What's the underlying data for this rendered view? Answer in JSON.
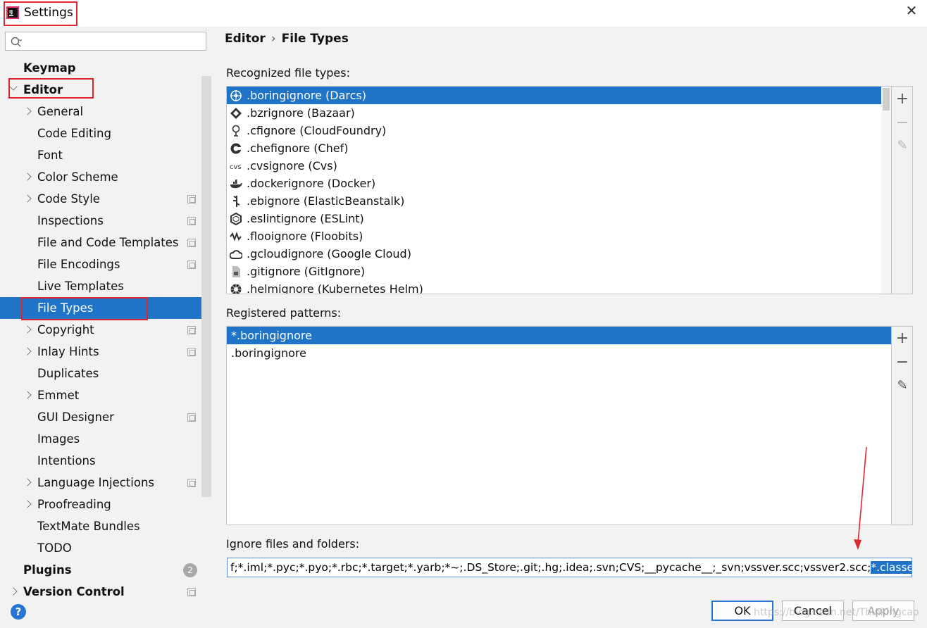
{
  "window": {
    "title": "Settings"
  },
  "sidebar": {
    "search_placeholder": "",
    "items": [
      {
        "label": "Keymap",
        "bold": true
      },
      {
        "label": "Editor",
        "bold": true
      },
      {
        "label": "General"
      },
      {
        "label": "Code Editing"
      },
      {
        "label": "Font"
      },
      {
        "label": "Color Scheme"
      },
      {
        "label": "Code Style"
      },
      {
        "label": "Inspections"
      },
      {
        "label": "File and Code Templates"
      },
      {
        "label": "File Encodings"
      },
      {
        "label": "Live Templates"
      },
      {
        "label": "File Types",
        "selected": true
      },
      {
        "label": "Copyright"
      },
      {
        "label": "Inlay Hints"
      },
      {
        "label": "Duplicates"
      },
      {
        "label": "Emmet"
      },
      {
        "label": "GUI Designer"
      },
      {
        "label": "Images"
      },
      {
        "label": "Intentions"
      },
      {
        "label": "Language Injections"
      },
      {
        "label": "Proofreading"
      },
      {
        "label": "TextMate Bundles"
      },
      {
        "label": "TODO"
      },
      {
        "label": "Plugins",
        "bold": true,
        "badge": "2"
      },
      {
        "label": "Version Control",
        "bold": true
      }
    ]
  },
  "breadcrumb": {
    "parent": "Editor",
    "separator": "›",
    "current": "File Types"
  },
  "recognized": {
    "label": "Recognized file types:",
    "items": [
      {
        "text": ".boringignore (Darcs)",
        "icon": "darcs-icon",
        "selected": true
      },
      {
        "text": ".bzrignore (Bazaar)",
        "icon": "bazaar-icon"
      },
      {
        "text": ".cfignore (CloudFoundry)",
        "icon": "cloudfoundry-icon"
      },
      {
        "text": ".chefignore (Chef)",
        "icon": "chef-icon"
      },
      {
        "text": ".cvsignore (Cvs)",
        "icon": "cvs-icon",
        "icon_text": "cvs"
      },
      {
        "text": ".dockerignore (Docker)",
        "icon": "docker-icon"
      },
      {
        "text": ".ebignore (ElasticBeanstalk)",
        "icon": "elasticbeanstalk-icon"
      },
      {
        "text": ".eslintignore (ESLint)",
        "icon": "eslint-icon"
      },
      {
        "text": ".flooignore (Floobits)",
        "icon": "floobits-icon"
      },
      {
        "text": ".gcloudignore (Google Cloud)",
        "icon": "google-cloud-icon"
      },
      {
        "text": ".gitignore (GitIgnore)",
        "icon": "gitignore-icon"
      },
      {
        "text": ".helmignore (Kubernetes Helm)",
        "icon": "helm-icon"
      }
    ]
  },
  "patterns": {
    "label": "Registered patterns:",
    "items": [
      {
        "text": "*.boringignore",
        "selected": true
      },
      {
        "text": ".boringignore"
      }
    ]
  },
  "tools": {
    "add": "+",
    "remove": "−",
    "edit": "✎"
  },
  "ignore": {
    "label": "Ignore files and folders:",
    "value_prefix": "f;*.iml;*.pyc;*.pyo;*.rbc;*.target;*.yarb;*~;.DS_Store;.git;.hg;.idea;.svn;CVS;__pycache__;_svn;vssver.scc;vssver2.scc;",
    "value_selected": "*.classes;*target;"
  },
  "buttons": {
    "help": "?",
    "ok": "OK",
    "cancel": "Cancel",
    "apply": "Apply"
  },
  "watermark": "https://blog.csdn.net/Thinkingcao",
  "colors": {
    "selection": "#1f74c7",
    "annotation": "#e0262e"
  }
}
